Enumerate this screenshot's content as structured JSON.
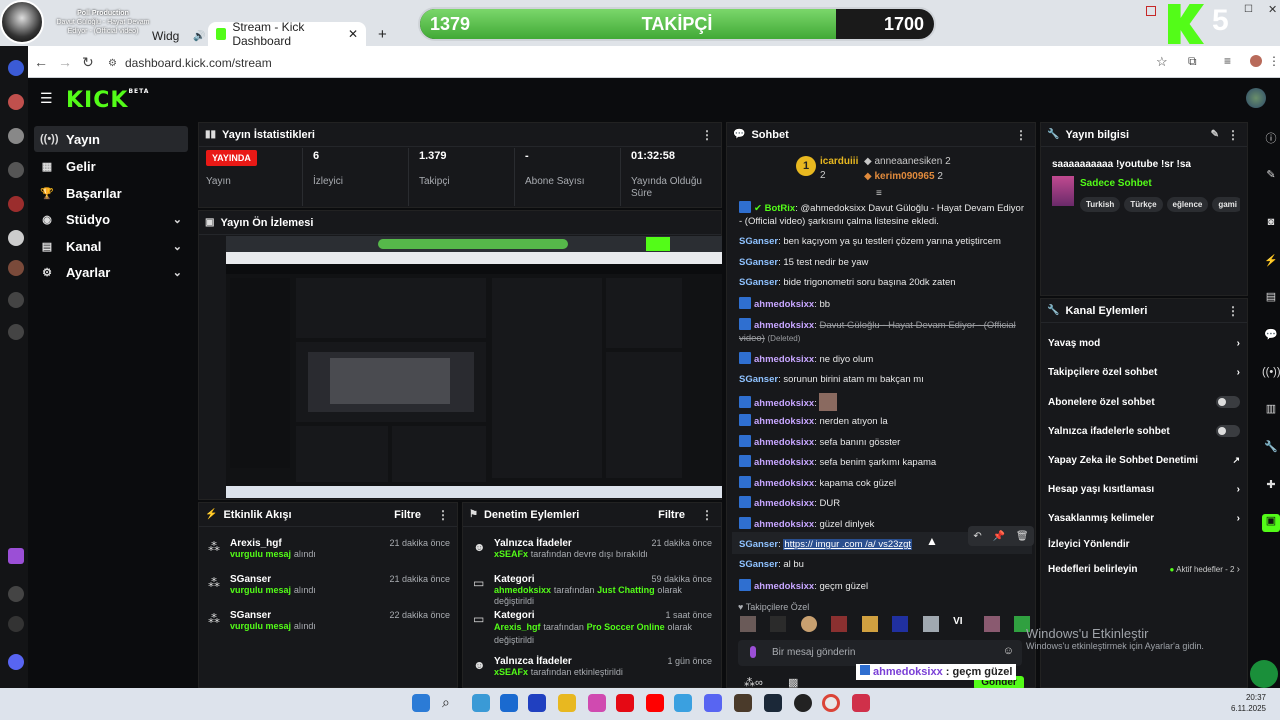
{
  "browser": {
    "tab1_label": "Widg",
    "tab2_label": "Stream - Kick Dashboard",
    "new_tab": "+",
    "url": "dashboard.kick.com/stream"
  },
  "overlay": {
    "channel_name": "Poll Production",
    "now_playing": "Davut Güloğlu - Hayat Devam Ediyor - (Official video)",
    "goal_current": "1379",
    "goal_label": "TAKİPÇİ",
    "goal_target": "1700",
    "goal_progress": 0.81,
    "kick_digit": "5"
  },
  "sidebar": {
    "items": [
      {
        "label": "Yayın",
        "icon": "broadcast-icon",
        "active": true
      },
      {
        "label": "Gelir",
        "icon": "revenue-icon"
      },
      {
        "label": "Başarılar",
        "icon": "trophy-icon"
      },
      {
        "label": "Stüdyo",
        "icon": "studio-icon"
      },
      {
        "label": "Kanal",
        "icon": "channel-icon"
      },
      {
        "label": "Ayarlar",
        "icon": "settings-icon"
      }
    ]
  },
  "stats": {
    "title": "Yayın İstatistikleri",
    "live_badge": "YAYINDA",
    "status_label": "Yayın",
    "viewers_value": "6",
    "viewers_label": "İzleyici",
    "followers_value": "1.379",
    "followers_label": "Takipçi",
    "subs_value": "-",
    "subs_label": "Abone Sayısı",
    "uptime_value": "01:32:58",
    "uptime_label": "Yayında Olduğu Süre"
  },
  "preview": {
    "title": "Yayın Ön İzlemesi"
  },
  "activity": {
    "title": "Etkinlik Akışı",
    "filter": "Filtre",
    "items": [
      {
        "user": "Arexis_hgf",
        "action": "vurgulu mesaj",
        "suffix": "alındı",
        "time": "21 dakika önce"
      },
      {
        "user": "SGanser",
        "action": "vurgulu mesaj",
        "suffix": "alındı",
        "time": "21 dakika önce"
      },
      {
        "user": "SGanser",
        "action": "vurgulu mesaj",
        "suffix": "alındı",
        "time": "22 dakika önce"
      }
    ]
  },
  "moderation": {
    "title": "Denetim Eylemleri",
    "filter": "Filtre",
    "items": [
      {
        "title": "Yalnızca İfadeler",
        "time": "21 dakika önce",
        "actor": "xSEAFx",
        "text": "tarafından devre dışı bırakıldı"
      },
      {
        "title": "Kategori",
        "time": "59 dakika önce",
        "actor": "ahmedoksixx",
        "text_mid": "tarafından",
        "category": "Just Chatting",
        "text": "olarak değiştirildi"
      },
      {
        "title": "Kategori",
        "time": "1 saat önce",
        "actor": "Arexis_hgf",
        "text_mid": "tarafından",
        "category": "Pro Soccer Online",
        "text": "olarak değiştirildi"
      },
      {
        "title": "Yalnızca İfadeler",
        "time": "1 gün önce",
        "actor": "xSEAFx",
        "text": "tarafından etkinleştirildi"
      }
    ]
  },
  "chat": {
    "title": "Sohbet",
    "leaderboard": {
      "rank": "1",
      "first_user": "icarduiii",
      "first_count": "2",
      "second_user": "anneaanesiken",
      "second_count": "2",
      "third_user": "kerim090965",
      "third_count": "2"
    },
    "messages": [
      {
        "user": "BotRix",
        "cls": "u-bot",
        "text": "@ahmedoksixx Davut Güloğlu - Hayat Devam Ediyor - (Official video) şarkısını çalma listesine ekledi."
      },
      {
        "user": "SGanser",
        "cls": "u-sg",
        "text": "ben kaçıyom ya şu testleri çözem yarına yetiştircem"
      },
      {
        "user": "SGanser",
        "cls": "u-sg",
        "text": "15 test nedir be yaw"
      },
      {
        "user": "SGanser",
        "cls": "u-sg",
        "text": "bide trigonometri soru başına 20dk zaten"
      },
      {
        "user": "ahmedoksixx",
        "cls": "u-ah",
        "text": "bb"
      },
      {
        "user": "ahmedoksixx",
        "cls": "u-ah",
        "deleted_text": "Davut Güloğlu - Hayat Devam Ediyor - (Official video)",
        "deleted_tag": "(Deleted)"
      },
      {
        "user": "ahmedoksixx",
        "cls": "u-ah",
        "text": "ne diyo olum"
      },
      {
        "user": "SGanser",
        "cls": "u-sg",
        "text": "sorunun birini atam mı bakçan mı"
      },
      {
        "user": "ahmedoksixx",
        "cls": "u-ah",
        "text": ""
      },
      {
        "user": "ahmedoksixx",
        "cls": "u-ah",
        "text": "nerden atıyon la"
      },
      {
        "user": "ahmedoksixx",
        "cls": "u-ah",
        "text": "sefa banını gösster"
      },
      {
        "user": "ahmedoksixx",
        "cls": "u-ah",
        "text": "sefa benim şarkımı kapama"
      },
      {
        "user": "ahmedoksixx",
        "cls": "u-ah",
        "text": "kapama cok güzel"
      },
      {
        "user": "ahmedoksixx",
        "cls": "u-ah",
        "text": "DUR"
      },
      {
        "user": "ahmedoksixx",
        "cls": "u-ah",
        "text": "güzel dinlyek"
      },
      {
        "user": "SGanser",
        "cls": "u-sg",
        "link": "https:// imgur .com /a/ vs23zgt"
      },
      {
        "user": "SGanser",
        "cls": "u-sg",
        "text": "al bu"
      },
      {
        "user": "ahmedoksixx",
        "cls": "u-ah",
        "text": "geçm güzel"
      }
    ],
    "emote_section": "Takipçilere Özel",
    "input_placeholder": "Bir mesaj gönderin",
    "send_button": "Gönder",
    "overlay_msg_user": "ahmedoksixx",
    "overlay_msg_text": ": geçm güzel"
  },
  "stream_info": {
    "title": "Yayın bilgisi",
    "stream_title": "saaaaaaaaaa !youtube !sr !sa",
    "category": "Sadece Sohbet",
    "tags": [
      "Turkish",
      "Türkçe",
      "eğlence",
      "gami"
    ]
  },
  "channel_actions": {
    "title": "Kanal Eylemleri",
    "items": [
      {
        "label": "Yavaş mod",
        "control": "chevron"
      },
      {
        "label": "Takipçilere özel sohbet",
        "control": "chevron"
      },
      {
        "label": "Abonelere özel sohbet",
        "control": "toggle"
      },
      {
        "label": "Yalnızca ifadelerle sohbet",
        "control": "toggle"
      },
      {
        "label": "Yapay Zeka ile Sohbet Denetimi",
        "control": "external"
      },
      {
        "label": "Hesap yaşı kısıtlaması",
        "control": "chevron"
      },
      {
        "label": "Yasaklanmış kelimeler",
        "control": "chevron"
      },
      {
        "label": "İzleyici Yönlendir",
        "control": "none"
      },
      {
        "label": "Hedefleri belirleyin",
        "control": "chevron",
        "status": "Aktif hedefler - 2"
      }
    ]
  },
  "windows": {
    "activate_title": "Windows'u Etkinleştir",
    "activate_sub": "Windows'u etkinleştirmek için Ayarlar'a gidin.",
    "time": "20:37",
    "date": "6.11.2025"
  },
  "colors": {
    "kick_green": "#53fc18",
    "live_red": "#e91916",
    "panel_bg": "#17181b",
    "page_bg": "#0b0c0e"
  }
}
